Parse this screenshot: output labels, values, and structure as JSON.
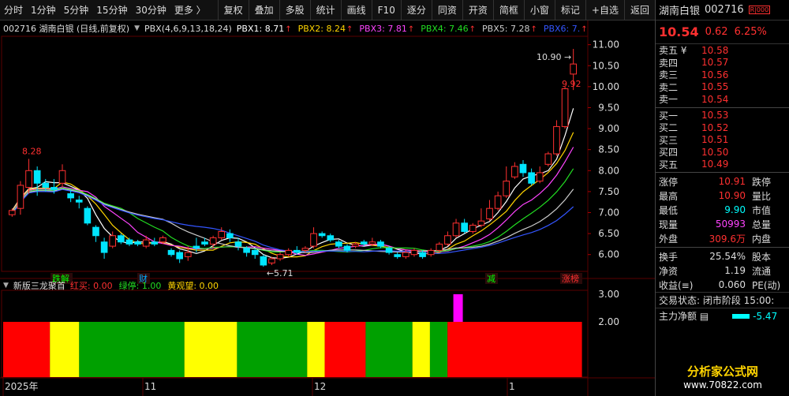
{
  "toolbar": {
    "periods": [
      "分时",
      "1分钟",
      "5分钟",
      "15分钟",
      "30分钟",
      "更多 〉"
    ],
    "buttons": [
      "复权",
      "叠加",
      "多股",
      "统计",
      "画线",
      "F10",
      "逐分",
      "同资",
      "开资",
      "简框",
      "小窗",
      "标记",
      "+自选",
      "返回"
    ]
  },
  "chart": {
    "stock": "002716 湖南白银 (日线,前复权)",
    "indicator": "PBX(4,6,9,13,18,24)",
    "pbx": [
      {
        "label": "PBX1: 8.71",
        "color": "#ffffff"
      },
      {
        "label": "PBX2: 8.24",
        "color": "#ffd400"
      },
      {
        "label": "PBX3: 7.81",
        "color": "#ff44ff"
      },
      {
        "label": "PBX4: 7.46",
        "color": "#22dd22"
      },
      {
        "label": "PBX5: 7.28",
        "color": "#cccccc"
      },
      {
        "label": "PBX6: 7.",
        "color": "#3355ff"
      }
    ],
    "annotations": {
      "high_left": "8.28",
      "low": "5.71",
      "high_right": "10.90",
      "close_label": "9.92"
    },
    "events": [
      "跌解",
      "财",
      "减",
      "涨榜"
    ],
    "sub_title": "新版三龙聚首",
    "sub_items": [
      {
        "label": "红买: 0.00",
        "color": "#ff3030"
      },
      {
        "label": "绿停: 1.00",
        "color": "#22dd22"
      },
      {
        "label": "黄观望: 0.00",
        "color": "#ffd400"
      }
    ],
    "date_labels": [
      "2025年",
      "11",
      "12",
      "1"
    ]
  },
  "chart_data": {
    "type": "candlestick",
    "y_axis_ticks": [
      6.0,
      6.5,
      7.0,
      7.5,
      8.0,
      8.5,
      9.0,
      9.5,
      10.0,
      10.5,
      11.0
    ],
    "ylim": [
      5.6,
      11.2
    ],
    "sub_y_ticks": [
      2.0,
      3.0
    ],
    "candles": [
      {
        "o": 6.95,
        "c": 7.05,
        "h": 7.1,
        "l": 6.9
      },
      {
        "o": 7.1,
        "c": 7.65,
        "h": 7.75,
        "l": 6.95
      },
      {
        "o": 7.6,
        "c": 8.0,
        "h": 8.28,
        "l": 7.45
      },
      {
        "o": 8.0,
        "c": 7.7,
        "h": 8.1,
        "l": 7.4
      },
      {
        "o": 7.7,
        "c": 7.6,
        "h": 7.8,
        "l": 7.5
      },
      {
        "o": 7.6,
        "c": 7.55,
        "h": 7.8,
        "l": 7.45
      },
      {
        "o": 7.7,
        "c": 8.0,
        "h": 8.15,
        "l": 7.6
      },
      {
        "o": 7.45,
        "c": 7.35,
        "h": 7.55,
        "l": 7.25
      },
      {
        "o": 7.3,
        "c": 7.25,
        "h": 7.4,
        "l": 7.1
      },
      {
        "o": 7.1,
        "c": 6.75,
        "h": 7.15,
        "l": 6.7
      },
      {
        "o": 6.65,
        "c": 6.45,
        "h": 6.7,
        "l": 6.3
      },
      {
        "o": 6.3,
        "c": 6.05,
        "h": 6.4,
        "l": 5.9
      },
      {
        "o": 6.2,
        "c": 6.45,
        "h": 6.55,
        "l": 6.15
      },
      {
        "o": 6.45,
        "c": 6.3,
        "h": 6.5,
        "l": 6.25
      },
      {
        "o": 6.35,
        "c": 6.25,
        "h": 6.4,
        "l": 6.2
      },
      {
        "o": 6.3,
        "c": 6.25,
        "h": 6.35,
        "l": 6.2
      },
      {
        "o": 6.2,
        "c": 6.35,
        "h": 6.45,
        "l": 6.15
      },
      {
        "o": 6.3,
        "c": 6.25,
        "h": 6.4,
        "l": 6.2
      },
      {
        "o": 6.3,
        "c": 6.4,
        "h": 6.45,
        "l": 6.25
      },
      {
        "o": 6.1,
        "c": 6.0,
        "h": 6.15,
        "l": 5.95
      },
      {
        "o": 6.05,
        "c": 5.9,
        "h": 6.1,
        "l": 5.8
      },
      {
        "o": 5.95,
        "c": 6.05,
        "h": 6.2,
        "l": 5.85
      },
      {
        "o": 6.2,
        "c": 6.15,
        "h": 6.4,
        "l": 6.05
      },
      {
        "o": 6.3,
        "c": 6.25,
        "h": 6.4,
        "l": 6.2
      },
      {
        "o": 6.25,
        "c": 6.4,
        "h": 6.45,
        "l": 6.15
      },
      {
        "o": 6.4,
        "c": 6.55,
        "h": 6.65,
        "l": 6.35
      },
      {
        "o": 6.5,
        "c": 6.4,
        "h": 6.6,
        "l": 6.3
      },
      {
        "o": 6.3,
        "c": 6.2,
        "h": 6.4,
        "l": 6.1
      },
      {
        "o": 6.15,
        "c": 6.05,
        "h": 6.2,
        "l": 5.95
      },
      {
        "o": 6.1,
        "c": 6.0,
        "h": 6.15,
        "l": 5.9
      },
      {
        "o": 5.95,
        "c": 5.75,
        "h": 6.0,
        "l": 5.71
      },
      {
        "o": 5.8,
        "c": 5.9,
        "h": 5.95,
        "l": 5.75
      },
      {
        "o": 5.9,
        "c": 6.0,
        "h": 6.05,
        "l": 5.85
      },
      {
        "o": 6.0,
        "c": 6.1,
        "h": 6.15,
        "l": 5.95
      },
      {
        "o": 6.1,
        "c": 6.05,
        "h": 6.2,
        "l": 6.0
      },
      {
        "o": 6.1,
        "c": 6.15,
        "h": 6.2,
        "l": 6.05
      },
      {
        "o": 6.2,
        "c": 6.5,
        "h": 6.65,
        "l": 6.15
      },
      {
        "o": 6.5,
        "c": 6.45,
        "h": 6.55,
        "l": 6.4
      },
      {
        "o": 6.45,
        "c": 6.35,
        "h": 6.5,
        "l": 6.3
      },
      {
        "o": 6.3,
        "c": 6.2,
        "h": 6.35,
        "l": 6.15
      },
      {
        "o": 6.2,
        "c": 6.1,
        "h": 6.25,
        "l": 6.05
      },
      {
        "o": 6.2,
        "c": 6.25,
        "h": 6.3,
        "l": 6.15
      },
      {
        "o": 6.3,
        "c": 6.25,
        "h": 6.35,
        "l": 6.2
      },
      {
        "o": 6.25,
        "c": 6.3,
        "h": 6.4,
        "l": 6.2
      },
      {
        "o": 6.3,
        "c": 6.2,
        "h": 6.35,
        "l": 6.15
      },
      {
        "o": 6.15,
        "c": 6.05,
        "h": 6.2,
        "l": 6.0
      },
      {
        "o": 6.0,
        "c": 5.95,
        "h": 6.05,
        "l": 5.9
      },
      {
        "o": 5.95,
        "c": 6.05,
        "h": 6.1,
        "l": 5.9
      },
      {
        "o": 6.0,
        "c": 6.1,
        "h": 6.15,
        "l": 5.95
      },
      {
        "o": 6.05,
        "c": 5.95,
        "h": 6.1,
        "l": 5.9
      },
      {
        "o": 6.0,
        "c": 6.1,
        "h": 6.15,
        "l": 5.95
      },
      {
        "o": 6.1,
        "c": 6.25,
        "h": 6.3,
        "l": 6.05
      },
      {
        "o": 6.25,
        "c": 6.45,
        "h": 6.55,
        "l": 6.2
      },
      {
        "o": 6.45,
        "c": 6.75,
        "h": 6.85,
        "l": 6.4
      },
      {
        "o": 6.75,
        "c": 6.55,
        "h": 6.85,
        "l": 6.5
      },
      {
        "o": 6.55,
        "c": 6.7,
        "h": 6.75,
        "l": 6.5
      },
      {
        "o": 6.7,
        "c": 6.8,
        "h": 7.1,
        "l": 6.65
      },
      {
        "o": 6.85,
        "c": 7.1,
        "h": 7.3,
        "l": 6.8
      },
      {
        "o": 7.1,
        "c": 7.4,
        "h": 7.5,
        "l": 7.05
      },
      {
        "o": 7.4,
        "c": 7.75,
        "h": 8.1,
        "l": 7.35
      },
      {
        "o": 7.85,
        "c": 8.1,
        "h": 8.2,
        "l": 7.8
      },
      {
        "o": 8.15,
        "c": 7.95,
        "h": 8.25,
        "l": 7.85
      },
      {
        "o": 7.95,
        "c": 7.7,
        "h": 8.05,
        "l": 7.65
      },
      {
        "o": 7.75,
        "c": 7.95,
        "h": 8.1,
        "l": 7.7
      },
      {
        "o": 8.15,
        "c": 8.4,
        "h": 8.45,
        "l": 8.1
      },
      {
        "o": 8.4,
        "c": 9.05,
        "h": 9.2,
        "l": 8.35
      },
      {
        "o": 9.05,
        "c": 9.95,
        "h": 10.0,
        "l": 9.0
      },
      {
        "o": 10.3,
        "c": 10.54,
        "h": 10.9,
        "l": 9.92
      }
    ],
    "ma_series": [
      {
        "name": "PBX1",
        "color": "#ffffff",
        "last": 8.71
      },
      {
        "name": "PBX2",
        "color": "#ffd400",
        "last": 8.24
      },
      {
        "name": "PBX3",
        "color": "#ff44ff",
        "last": 7.81
      },
      {
        "name": "PBX4",
        "color": "#22dd22",
        "last": 7.46
      },
      {
        "name": "PBX5",
        "color": "#cccccc",
        "last": 7.28
      },
      {
        "name": "PBX6",
        "color": "#3355ff",
        "last": 7.0
      }
    ],
    "signal_bands": [
      {
        "color": "red",
        "from": 0,
        "to": 8
      },
      {
        "color": "yellow",
        "from": 8,
        "to": 13
      },
      {
        "color": "green",
        "from": 13,
        "to": 31
      },
      {
        "color": "yellow",
        "from": 31,
        "to": 40
      },
      {
        "color": "green",
        "from": 40,
        "to": 52
      },
      {
        "color": "yellow",
        "from": 52,
        "to": 55
      },
      {
        "color": "red",
        "from": 55,
        "to": 62
      },
      {
        "color": "green",
        "from": 62,
        "to": 70
      },
      {
        "color": "yellow",
        "from": 70,
        "to": 73
      },
      {
        "color": "green",
        "from": 73,
        "to": 76
      },
      {
        "color": "red",
        "from": 76,
        "to": 99
      }
    ],
    "magenta_bar": {
      "index": 77,
      "value": 3.0
    }
  },
  "quote": {
    "name": "湖南白银",
    "code": "002716",
    "badge": "R|000",
    "price": "10.54",
    "change": "0.62",
    "pct": "6.25%",
    "asks": [
      {
        "label": "卖五 ¥",
        "price": "10.58"
      },
      {
        "label": "卖四",
        "price": "10.57"
      },
      {
        "label": "卖三",
        "price": "10.56"
      },
      {
        "label": "卖二",
        "price": "10.55"
      },
      {
        "label": "卖一",
        "price": "10.54"
      }
    ],
    "bids": [
      {
        "label": "买一",
        "price": "10.53"
      },
      {
        "label": "买二",
        "price": "10.52"
      },
      {
        "label": "买三",
        "price": "10.51"
      },
      {
        "label": "买四",
        "price": "10.50"
      },
      {
        "label": "买五",
        "price": "10.49"
      }
    ],
    "stats": [
      {
        "l1": "涨停",
        "v1": "10.91",
        "c1": "#ff3030",
        "l2": "跌停"
      },
      {
        "l1": "最高",
        "v1": "10.90",
        "c1": "#ff3030",
        "l2": "量比"
      },
      {
        "l1": "最低",
        "v1": "9.90",
        "c1": "#00ffff",
        "l2": "市值"
      },
      {
        "l1": "现量",
        "v1": "50993",
        "c1": "#ff44ff",
        "l2": "总量"
      },
      {
        "l1": "外盘",
        "v1": "309.6万",
        "c1": "#ff3030",
        "l2": "内盘"
      }
    ],
    "stats2": [
      {
        "l1": "换手",
        "v1": "25.54%",
        "c1": "#ddd",
        "l2": "股本"
      },
      {
        "l1": "净资",
        "v1": "1.19",
        "c1": "#ddd",
        "l2": "流通"
      },
      {
        "l1": "收益(≡)",
        "v1": "0.060",
        "c1": "#ddd",
        "l2": "PE(动)"
      }
    ],
    "status": "交易状态: 闭市阶段 15:00:",
    "flow_label": "主力净额 ▤",
    "flow_value": "-5.47",
    "logo_text": "分析家公式网",
    "logo_url": "www.70822.com"
  },
  "colors": {
    "up": "#ff3030",
    "down": "#00e5ff",
    "bg": "#000000"
  }
}
